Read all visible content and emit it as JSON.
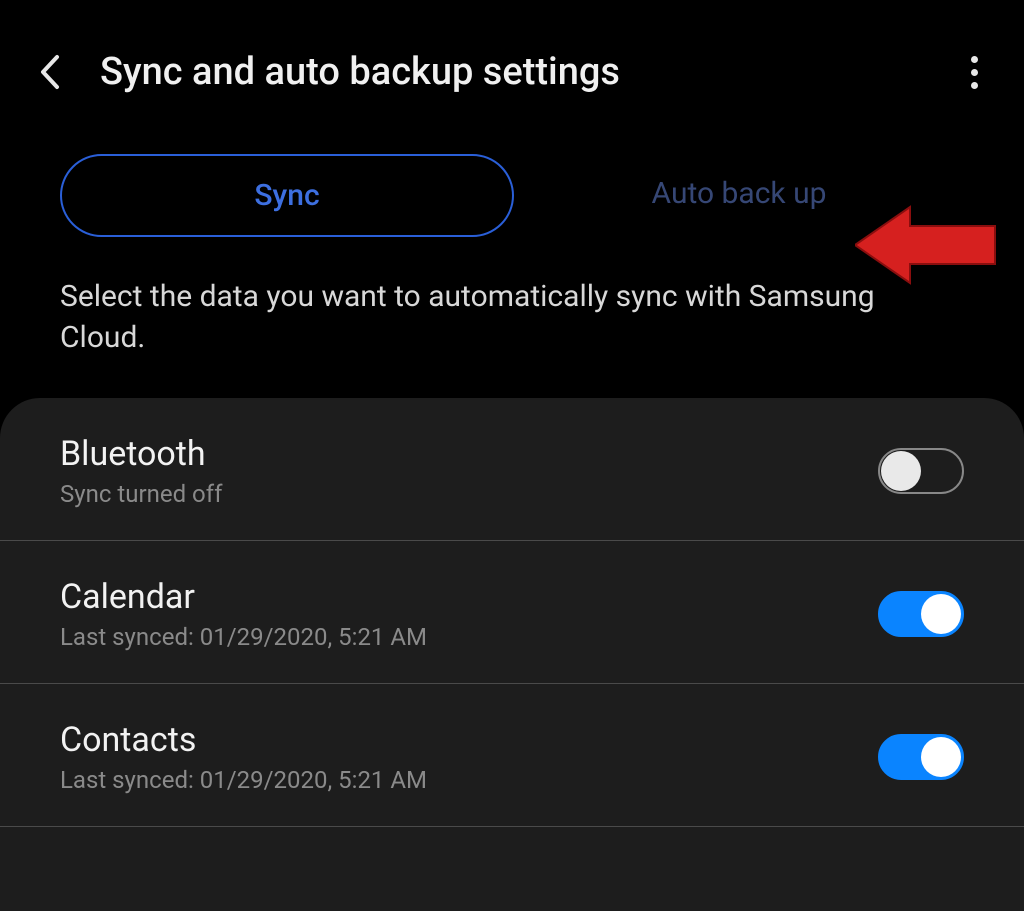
{
  "header": {
    "title": "Sync and auto backup settings"
  },
  "tabs": {
    "sync": "Sync",
    "auto_backup": "Auto back up"
  },
  "description": "Select the data you want to automatically sync with Samsung Cloud.",
  "items": [
    {
      "title": "Bluetooth",
      "sub": "Sync turned off",
      "on": false
    },
    {
      "title": "Calendar",
      "sub": "Last synced: 01/29/2020, 5:21 AM",
      "on": true
    },
    {
      "title": "Contacts",
      "sub": "Last synced: 01/29/2020, 5:21 AM",
      "on": true
    }
  ],
  "colors": {
    "accent": "#0a84ff",
    "tab_border": "#2a5fd8",
    "arrow": "#d6201f"
  }
}
